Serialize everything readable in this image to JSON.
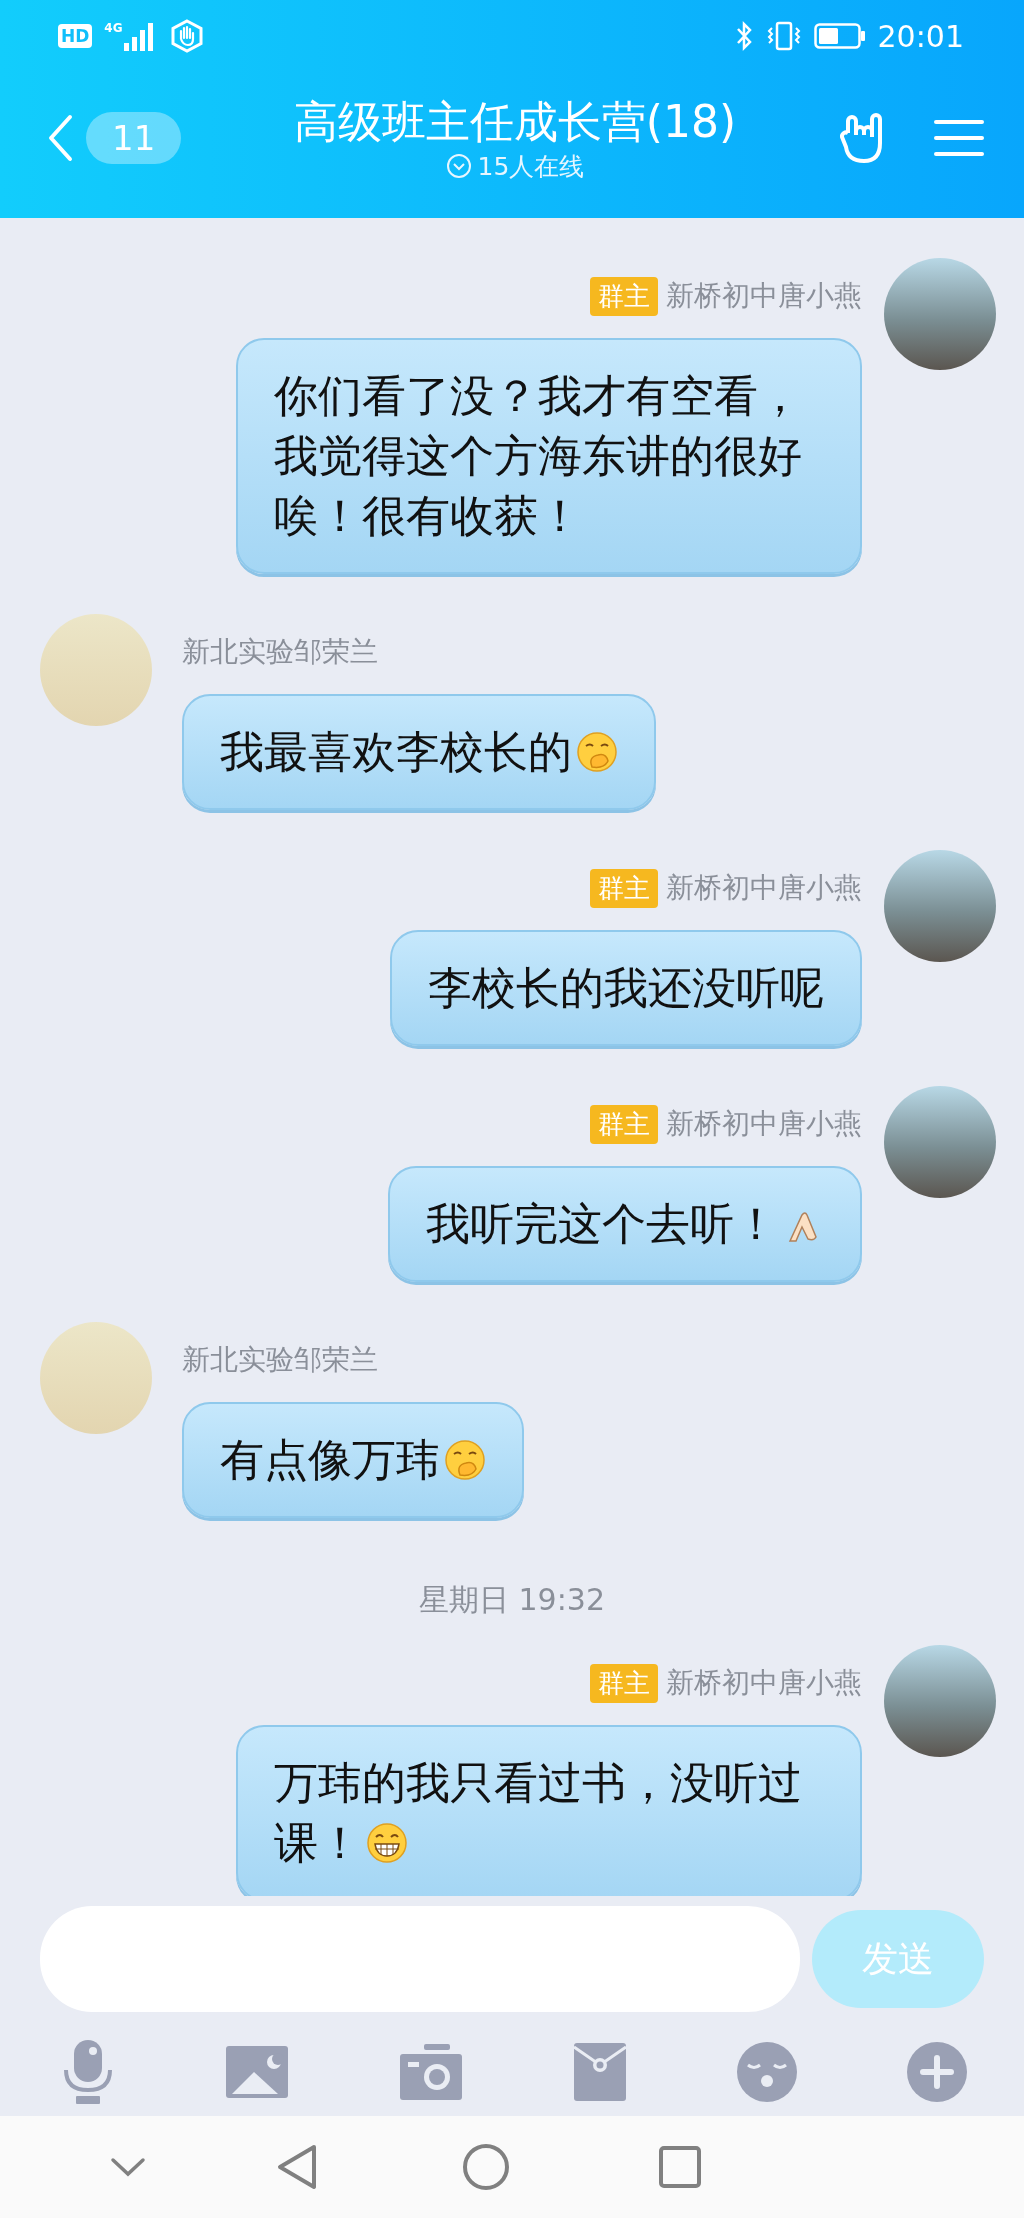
{
  "status_bar": {
    "hd": "HD",
    "network": "4G",
    "time": "20:01"
  },
  "header": {
    "unread": "11",
    "title": "高级班主任成长营(18)",
    "subtitle": "15人在线"
  },
  "messages": [
    {
      "kind": "outgoing",
      "role": "群主",
      "sender": "新桥初中唐小燕",
      "text": "你们看了没？我才有空看，我觉得这个方海东讲的很好唉！很有收获！"
    },
    {
      "kind": "incoming",
      "sender": "新北实验邹荣兰",
      "text": "我最喜欢李校长的",
      "emoji": {
        "kind": "cover-mouth"
      }
    },
    {
      "kind": "outgoing",
      "role": "群主",
      "sender": "新桥初中唐小燕",
      "text": "李校长的我还没听呢"
    },
    {
      "kind": "outgoing",
      "role": "群主",
      "sender": "新桥初中唐小燕",
      "text": "我听完这个去听！",
      "emoji": {
        "kind": "pray"
      }
    },
    {
      "kind": "incoming",
      "sender": "新北实验邹荣兰",
      "text": "有点像万玮",
      "emoji": {
        "kind": "cover-mouth"
      }
    },
    {
      "kind": "time",
      "text": "星期日 19:32"
    },
    {
      "kind": "outgoing",
      "role": "群主",
      "sender": "新桥初中唐小燕",
      "text": "万玮的我只看过书，没听过课！",
      "emoji": {
        "kind": "grin"
      }
    }
  ],
  "composer": {
    "send": "发送"
  }
}
